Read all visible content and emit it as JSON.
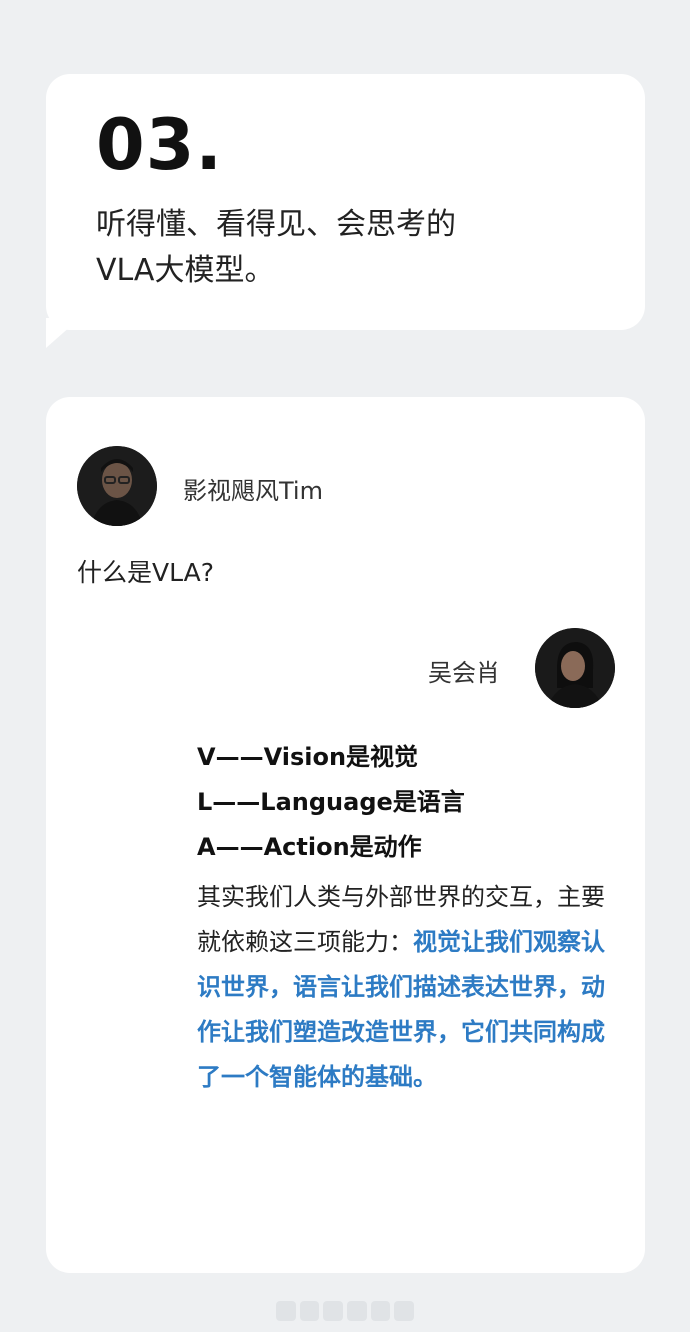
{
  "header": {
    "number": "03.",
    "title_line1": "听得懂、看得见、会思考的",
    "title_line2": "VLA大模型。"
  },
  "chat": {
    "host": {
      "name": "影视飓风Tim",
      "avatar_icon": "host-avatar-photo"
    },
    "question": "什么是VLA?",
    "guest": {
      "name": "吴会肖",
      "avatar_icon": "guest-avatar-photo"
    },
    "definitions": [
      "V——Vision是视觉",
      "L——Language是语言",
      "A——Action是动作"
    ],
    "answer_plain": "其实我们人类与外部世界的交互，主要就依赖这三项能力：",
    "answer_highlight": "视觉让我们观察认识世界，语言让我们描述表达世界，动作让我们塑造改造世界，它们共同构成了一个智能体的基础。",
    "highlight_color": "#2d7bc4"
  }
}
